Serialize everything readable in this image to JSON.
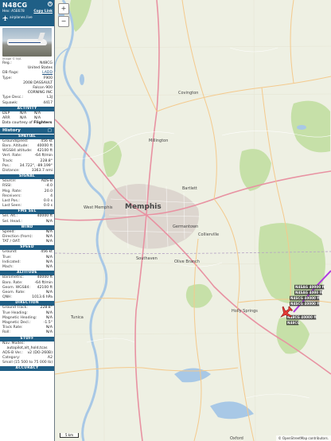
{
  "header": {
    "registration_title": "N48CG",
    "hex_label": "Hex:",
    "hex": "A5E678",
    "copy_link": "Copy Link",
    "site": "airplanes.live",
    "image_credit": "Image © N/A"
  },
  "aircraft": [
    {
      "k": "Reg.:",
      "v": "N48CG"
    },
    {
      "k": "",
      "v": "United States"
    },
    {
      "k": "DB flags:",
      "v": "LADD",
      "link": true
    },
    {
      "k": "Type:",
      "v": "F900"
    },
    {
      "k": "",
      "v": "2008 DASSAULT Falcon 900",
      "wrap": true
    },
    {
      "k": "",
      "v": "CORNING INC"
    },
    {
      "k": "Type Desc.:",
      "v": "L3J"
    },
    {
      "k": "Squawk:",
      "v": "4417"
    }
  ],
  "activity": {
    "title": "ACTIVITY",
    "rows": [
      {
        "a": "DEP",
        "b": "N/A",
        "c": "N/A"
      },
      {
        "a": "ARR",
        "b": "N/A",
        "c": "N/A"
      }
    ],
    "courtesy_prefix": "Data courtesy of",
    "courtesy_brand": "Flighters"
  },
  "history_title": "History",
  "sections": [
    {
      "title": "SPATIAL",
      "rows": [
        {
          "k": "Groundspeed:",
          "v": "456 kt"
        },
        {
          "k": "Baro. Altitude:",
          "v": "40000 ft"
        },
        {
          "k": "WGS84 altitude:",
          "v": "42100 ft"
        },
        {
          "k": "Vert. Rate:",
          "v": "-64 ft/min"
        },
        {
          "k": "Track:",
          "v": "228.8°"
        },
        {
          "k": "Pos.:",
          "v": "34.722°, -89.199°"
        },
        {
          "k": "Distance:",
          "v": "3363.7 nmi"
        }
      ]
    },
    {
      "title": "SIGNAL",
      "rows": [
        {
          "k": "Source:",
          "v": "ADS-B"
        },
        {
          "k": "RSSI:",
          "v": "-4.0"
        },
        {
          "k": "Msg. Rate:",
          "v": "20.0"
        },
        {
          "k": "Receivers:",
          "v": "4"
        },
        {
          "k": "Last Pos.:",
          "v": "0.0 s"
        },
        {
          "k": "Last Seen:",
          "v": "0.0 s"
        }
      ]
    },
    {
      "title": "FMS SEL",
      "rows": [
        {
          "k": "Sel. Alt.:",
          "v": "40000 ft"
        },
        {
          "k": "Sel. Head.:",
          "v": "N/A"
        }
      ]
    },
    {
      "title": "WIND",
      "rows": [
        {
          "k": "Speed:",
          "v": "N/A"
        },
        {
          "k": "Direction (from):",
          "v": "N/A"
        },
        {
          "k": "TAT / OAT:",
          "v": "N/A"
        }
      ]
    },
    {
      "title": "SPEED",
      "rows": [
        {
          "k": "Ground:",
          "v": "456 kt"
        },
        {
          "k": "True:",
          "v": "N/A"
        },
        {
          "k": "Indicated:",
          "v": "N/A"
        },
        {
          "k": "Mach:",
          "v": "N/A"
        }
      ]
    },
    {
      "title": "ALTITUDE",
      "rows": [
        {
          "k": "Barometric:",
          "v": "40000 ft"
        },
        {
          "k": "Baro. Rate:",
          "v": "-64 ft/min"
        },
        {
          "k": "Geom. WGS84:",
          "v": "42100 ft"
        },
        {
          "k": "Geom. Rate:",
          "v": "N/A"
        },
        {
          "k": "QNH:",
          "v": "1013.6 hPa"
        }
      ]
    },
    {
      "title": "DIRECTION",
      "rows": [
        {
          "k": "Ground Track:",
          "v": "228.8°"
        },
        {
          "k": "True Heading:",
          "v": "N/A"
        },
        {
          "k": "Magnetic Heading:",
          "v": "N/A"
        },
        {
          "k": "Magnetic Decl.:",
          "v": "-1.5°"
        },
        {
          "k": "Track Rate:",
          "v": "N/A"
        },
        {
          "k": "Roll:",
          "v": "N/A"
        }
      ]
    }
  ],
  "stuff": {
    "title": "STUFF",
    "nav_modes_label": "Nav. Modes:",
    "nav_modes_value": "autopilot,alt_hold,tcas",
    "rows": [
      {
        "k": "ADS-B Ver.:",
        "v": "v2 (DO-260B)"
      },
      {
        "k": "Category:",
        "v": "A2"
      }
    ],
    "category_desc": "Small (15 500 to 75 000 lb)"
  },
  "accuracy_title": "ACCURACY",
  "map": {
    "zoom_in": "+",
    "zoom_out": "−",
    "scale_label": "5 km",
    "attribution": "© OpenStreetMap contributors.",
    "cities": [
      {
        "name": "Memphis",
        "big": true
      },
      {
        "name": "Southaven"
      },
      {
        "name": "Olive Branch"
      },
      {
        "name": "Germantown"
      },
      {
        "name": "Collierville"
      },
      {
        "name": "Millington"
      },
      {
        "name": "Covington"
      },
      {
        "name": "West Memphis"
      },
      {
        "name": "Oxford"
      },
      {
        "name": "Holly Springs"
      },
      {
        "name": "Bartlett"
      },
      {
        "name": "Tunica"
      }
    ],
    "plane_labels": [
      {
        "label": "N4SAG 40000 ft"
      },
      {
        "label": "N4SAG 4000 ft"
      },
      {
        "label": "N4SCG 40000 ft"
      },
      {
        "label": "N4SCG 40000 ft"
      },
      {
        "label": "N48CG 40000 ft"
      },
      {
        "label": "N48CG"
      }
    ],
    "colors": {
      "water": "#a8c8e6",
      "land": "#eef0e3",
      "park": "#c6e0a8",
      "primary_road": "#e892a2",
      "secondary_road": "#f4c98c",
      "track": "#b03ae0",
      "plane": "#e53935"
    }
  }
}
